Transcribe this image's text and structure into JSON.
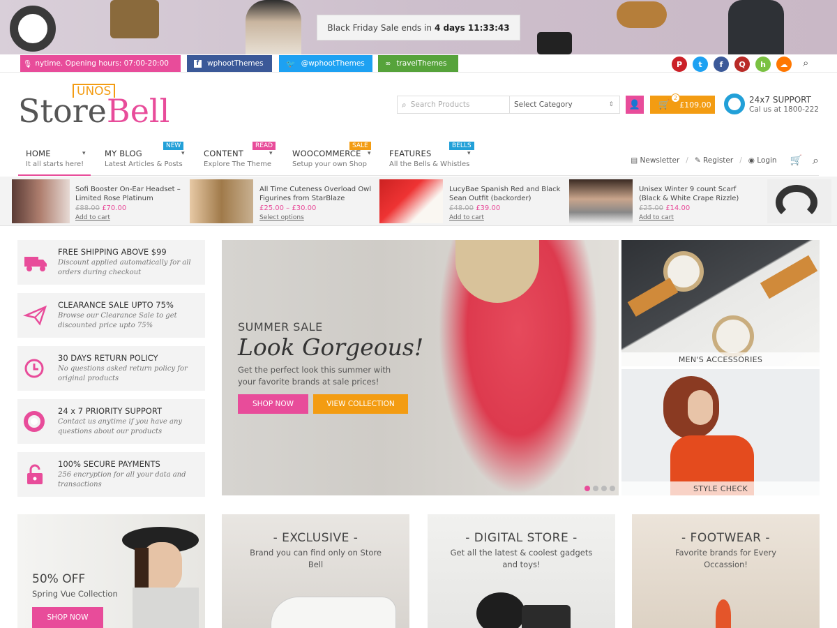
{
  "banner": {
    "countdown_prefix": "Black Friday Sale ends in",
    "countdown_value": "4 days 11:33:43"
  },
  "social": {
    "announcement": "nytime. Opening hours: 07:00-20:00",
    "facebook": "wphootThemes",
    "twitter": "@wphootThemes",
    "tripadvisor": "travelThemes",
    "icons": [
      "pinterest-icon",
      "twitter-icon",
      "facebook-icon",
      "quora-icon",
      "houzz-icon",
      "soundcloud-icon"
    ],
    "colors": {
      "pinterest": "#cb2027",
      "twitter": "#1da1f2",
      "facebook": "#3b5998",
      "quora": "#b92b27",
      "houzz": "#7ac142",
      "soundcloud": "#ff7700"
    }
  },
  "logo": {
    "tag": "UNOS",
    "part1": "Store",
    "part2": "Bell"
  },
  "search": {
    "placeholder": "Search Products",
    "category": "Select Category"
  },
  "cart": {
    "count": "2",
    "total": "£109.00"
  },
  "support": {
    "title": "24x7 SUPPORT",
    "phone": "Cal us at 1800-222"
  },
  "nav": {
    "items": [
      {
        "title": "HOME",
        "sub": "It all starts here!",
        "tag": ""
      },
      {
        "title": "MY BLOG",
        "sub": "Latest Articles & Posts",
        "tag": "NEW"
      },
      {
        "title": "CONTENT",
        "sub": "Explore The Theme",
        "tag": "READ"
      },
      {
        "title": "WOOCOMMERCE",
        "sub": "Setup your own Shop",
        "tag": "SALE"
      },
      {
        "title": "FEATURES",
        "sub": "All the Bells & Whistles",
        "tag": "BELLS"
      }
    ],
    "newsletter": "Newsletter",
    "register": "Register",
    "login": "Login"
  },
  "products": [
    {
      "title": "Sofi Booster On-Ear Headset – Limited Rose Platinum",
      "old": "£88.00",
      "new": "£70.00",
      "action": "Add to cart"
    },
    {
      "title": "All Time Cuteness Overload Owl Figurines from StarBlaze",
      "old": "",
      "new": "£25.00 – £30.00",
      "action": "Select options"
    },
    {
      "title": "LucyBae Spanish Red and Black Sean Outfit (backorder)",
      "old": "£48.00",
      "new": "£39.00",
      "action": "Add to cart"
    },
    {
      "title": "Unisex Winter 9 count Scarf (Black & White Crape Rizzle)",
      "old": "£25.00",
      "new": "£14.00",
      "action": "Add to cart"
    }
  ],
  "features": [
    {
      "title": "FREE SHIPPING ABOVE $99",
      "desc": "Discount applied automatically for all orders during checkout"
    },
    {
      "title": "CLEARANCE SALE UPTO 75%",
      "desc": "Browse our Clearance Sale to get discounted price upto 75%"
    },
    {
      "title": "30 DAYS RETURN POLICY",
      "desc": "No questions asked return policy for original products"
    },
    {
      "title": "24 x 7 PRIORITY SUPPORT",
      "desc": "Contact us anytime if you have any questions about our products"
    },
    {
      "title": "100% SECURE PAYMENTS",
      "desc": "256 encryption for all your data and transactions"
    }
  ],
  "hero": {
    "kicker": "SUMMER SALE",
    "headline": "Look Gorgeous!",
    "text": "Get the perfect look this summer with your favorite brands at sale prices!",
    "btn1": "SHOP NOW",
    "btn2": "VIEW COLLECTION"
  },
  "side_banners": {
    "top": "MEN'S ACCESSORIES",
    "bottom": "STYLE CHECK"
  },
  "tiles": [
    {
      "title": "50% OFF",
      "desc": "Spring Vue Collection",
      "btn": "SHOP NOW"
    },
    {
      "title": "- EXCLUSIVE -",
      "desc": "Brand you can find only on Store Bell"
    },
    {
      "title": "- DIGITAL STORE -",
      "desc": "Get all the latest & coolest gadgets and toys!"
    },
    {
      "title": "- FOOTWEAR -",
      "desc": "Favorite brands for Every Occassion!"
    }
  ],
  "accent": {
    "pink": "#e84c9a",
    "orange": "#f39c12",
    "blue": "#22a0d8"
  }
}
